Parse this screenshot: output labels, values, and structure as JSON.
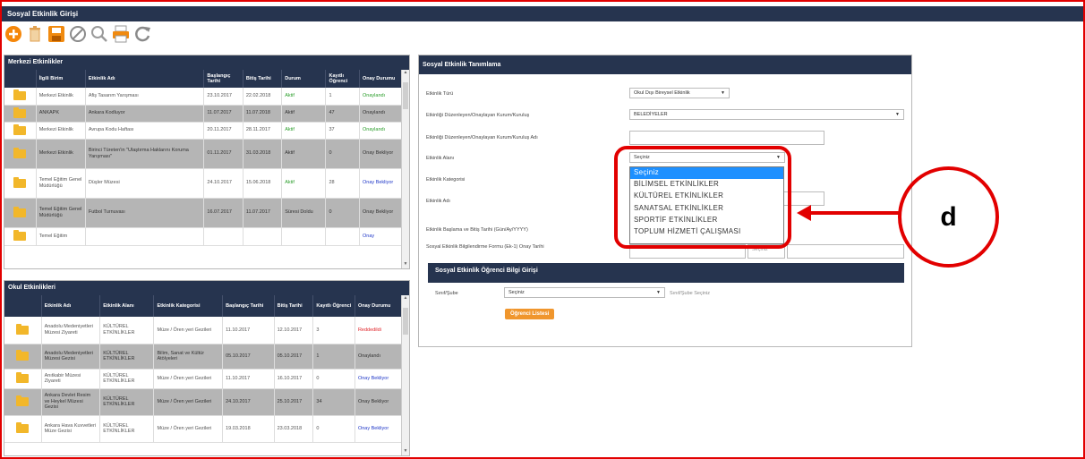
{
  "app": {
    "title": "Sosyal Etkinlik Girişi"
  },
  "toolbar": {
    "icons": [
      "add-icon",
      "delete-icon",
      "save-icon",
      "cancel-icon",
      "search-icon",
      "print-icon",
      "refresh-icon"
    ]
  },
  "merkezi": {
    "title": "Merkezi Etkinlikler",
    "headers": [
      "",
      "İlgili Birim",
      "Etkinlik Adı",
      "Başlangıç Tarihi",
      "Bitiş Tarihi",
      "Durum",
      "Kayıtlı Öğrenci",
      "Onay Durumu"
    ],
    "rows": [
      {
        "birim": "Merkezi Etkinlik",
        "ad": "Afiş Tasarım Yarışması",
        "bas": "23.10.2017",
        "bit": "22.02.2018",
        "durum": "Aktif",
        "kayitli": "1",
        "onay": "Onaylandı",
        "onayColor": "green"
      },
      {
        "birim": "ANKAPK",
        "ad": "Ankara Kodluyor",
        "bas": "11.07.2017",
        "bit": "11.07.2018",
        "durum": "Aktif",
        "kayitli": "47",
        "onay": "Onaylandı",
        "onayColor": "green"
      },
      {
        "birim": "Merkezi Etkinlik",
        "ad": "Avrupa Kodu Haftası",
        "bas": "20.11.2017",
        "bit": "28.11.2017",
        "durum": "Aktif",
        "kayitli": "37",
        "onay": "Onaylandı",
        "onayColor": "green"
      },
      {
        "birim": "Merkezi Etkinlik",
        "ad": "Birinci Türeten'in \"Ulaştırma Haklarını Koruma Yarışması\"",
        "bas": "01.11.2017",
        "bit": "31.03.2018",
        "durum": "Aktif",
        "kayitli": "0",
        "onay": "Onay Bekliyor",
        "onayColor": "blue"
      },
      {
        "birim": "Temel Eğitim Genel Müdürlüğü",
        "ad": "Düşler Müzesi",
        "bas": "24.10.2017",
        "bit": "15.06.2018",
        "durum": "Aktif",
        "kayitli": "28",
        "onay": "Onay Bekliyor",
        "onayColor": "blue"
      },
      {
        "birim": "Temel Eğitim Genel Müdürlüğü",
        "ad": "Futbol Turnuvası",
        "bas": "16.07.2017",
        "bit": "11.07.2017",
        "durum": "Süresi Doldu",
        "kayitli": "0",
        "onay": "Onay Bekliyor",
        "onayColor": "blue"
      },
      {
        "birim": "Temel Eğitim",
        "ad": "",
        "bas": "",
        "bit": "",
        "durum": "",
        "kayitli": "",
        "onay": "Onay",
        "onayColor": "blue"
      }
    ]
  },
  "okul": {
    "title": "Okul Etkinlikleri",
    "headers": [
      "",
      "Etkinlik Adı",
      "Etkinlik Alanı",
      "Etkinlik Kategorisi",
      "Başlangıç Tarihi",
      "Bitiş Tarihi",
      "Kayıtlı Öğrenci",
      "Onay Durumu"
    ],
    "rows": [
      {
        "ad": "Anadolu Medeniyetleri Müzesi Ziyareti",
        "alan": "KÜLTÜREL ETKİNLİKLER",
        "kat": "Müze / Ören yeri Gezileri",
        "bas": "11.10.2017",
        "bit": "12.10.2017",
        "kayitli": "3",
        "onay": "Reddedildi",
        "onayColor": "red"
      },
      {
        "ad": "Anadolu Medeniyetleri Müzesi Gezisi",
        "alan": "KÜLTÜREL ETKİNLİKLER",
        "kat": "Bilim, Sanat ve Kültür Atölyeleri",
        "bas": "05.10.2017",
        "bit": "05.10.2017",
        "kayitli": "1",
        "onay": "Onaylandı",
        "onayColor": "green"
      },
      {
        "ad": "Anıtkabir Müzesi Ziyareti",
        "alan": "KÜLTÜREL ETKİNLİKLER",
        "kat": "Müze / Ören yeri Gezileri",
        "bas": "11.10.2017",
        "bit": "16.10.2017",
        "kayitli": "0",
        "onay": "Onay Bekliyor",
        "onayColor": "blue"
      },
      {
        "ad": "Ankara Devlet Resim ve Heykel Müzesi Gezisi",
        "alan": "KÜLTÜREL ETKİNLİKLER",
        "kat": "Müze / Ören yeri Gezileri",
        "bas": "24.10.2017",
        "bit": "25.10.2017",
        "kayitli": "34",
        "onay": "Onay Bekliyor",
        "onayColor": "blue"
      },
      {
        "ad": "Ankara Hava Kuvvetleri Müze Gezisi",
        "alan": "KÜLTÜREL ETKİNLİKLER",
        "kat": "Müze / Ören yeri Gezileri",
        "bas": "19.03.2018",
        "bit": "23.03.2018",
        "kayitli": "0",
        "onay": "Onay Bekliyor",
        "onayColor": "blue"
      }
    ]
  },
  "tanimlama": {
    "title": "Sosyal Etkinlik Tanımlama",
    "labels": {
      "turu": "Etkinlik Türü",
      "kurum": "Etkinliği Düzenleyen/Onaylayan Kurum/Kuruluş",
      "kurumAdi": "Etkinliği Düzenleyen/Onaylayan Kurum/Kuruluş Adı",
      "alani": "Etkinlik Alanı",
      "kategori": "Etkinlik Kategorisi",
      "adi": "Etkinlik Adı",
      "tarih": "Etkinlik Başlama ve Bitiş Tarihi (Gün/Ay/YYYY)",
      "form": "Sosyal Etkinlik Bilgilendirme Formu (Ek-1) Onay Tarihi"
    },
    "values": {
      "turu": "Okul Dışı Bireysel Etkinlik",
      "kurum": "BELEDİYELER",
      "alani": "Seçiniz",
      "sec": "Seçiniz"
    },
    "dropdown": [
      "Seçiniz",
      "BİLİMSEL ETKİNLİKLER",
      "KÜLTÜREL ETKİNLİKLER",
      "SANATSAL ETKİNLİKLER",
      "SPORTİF ETKİNLİKLER",
      "TOPLUM HİZMETİ ÇALIŞMASI"
    ]
  },
  "ogrenci": {
    "title": "Sosyal Etkinlik Öğrenci Bilgi Girişi",
    "label": "Sınıf/Şube",
    "value": "Seçiniz",
    "hint": "Sınıf/Şube Seçiniz",
    "button": "Öğrenci Listesi"
  },
  "callout": {
    "letter": "d"
  }
}
